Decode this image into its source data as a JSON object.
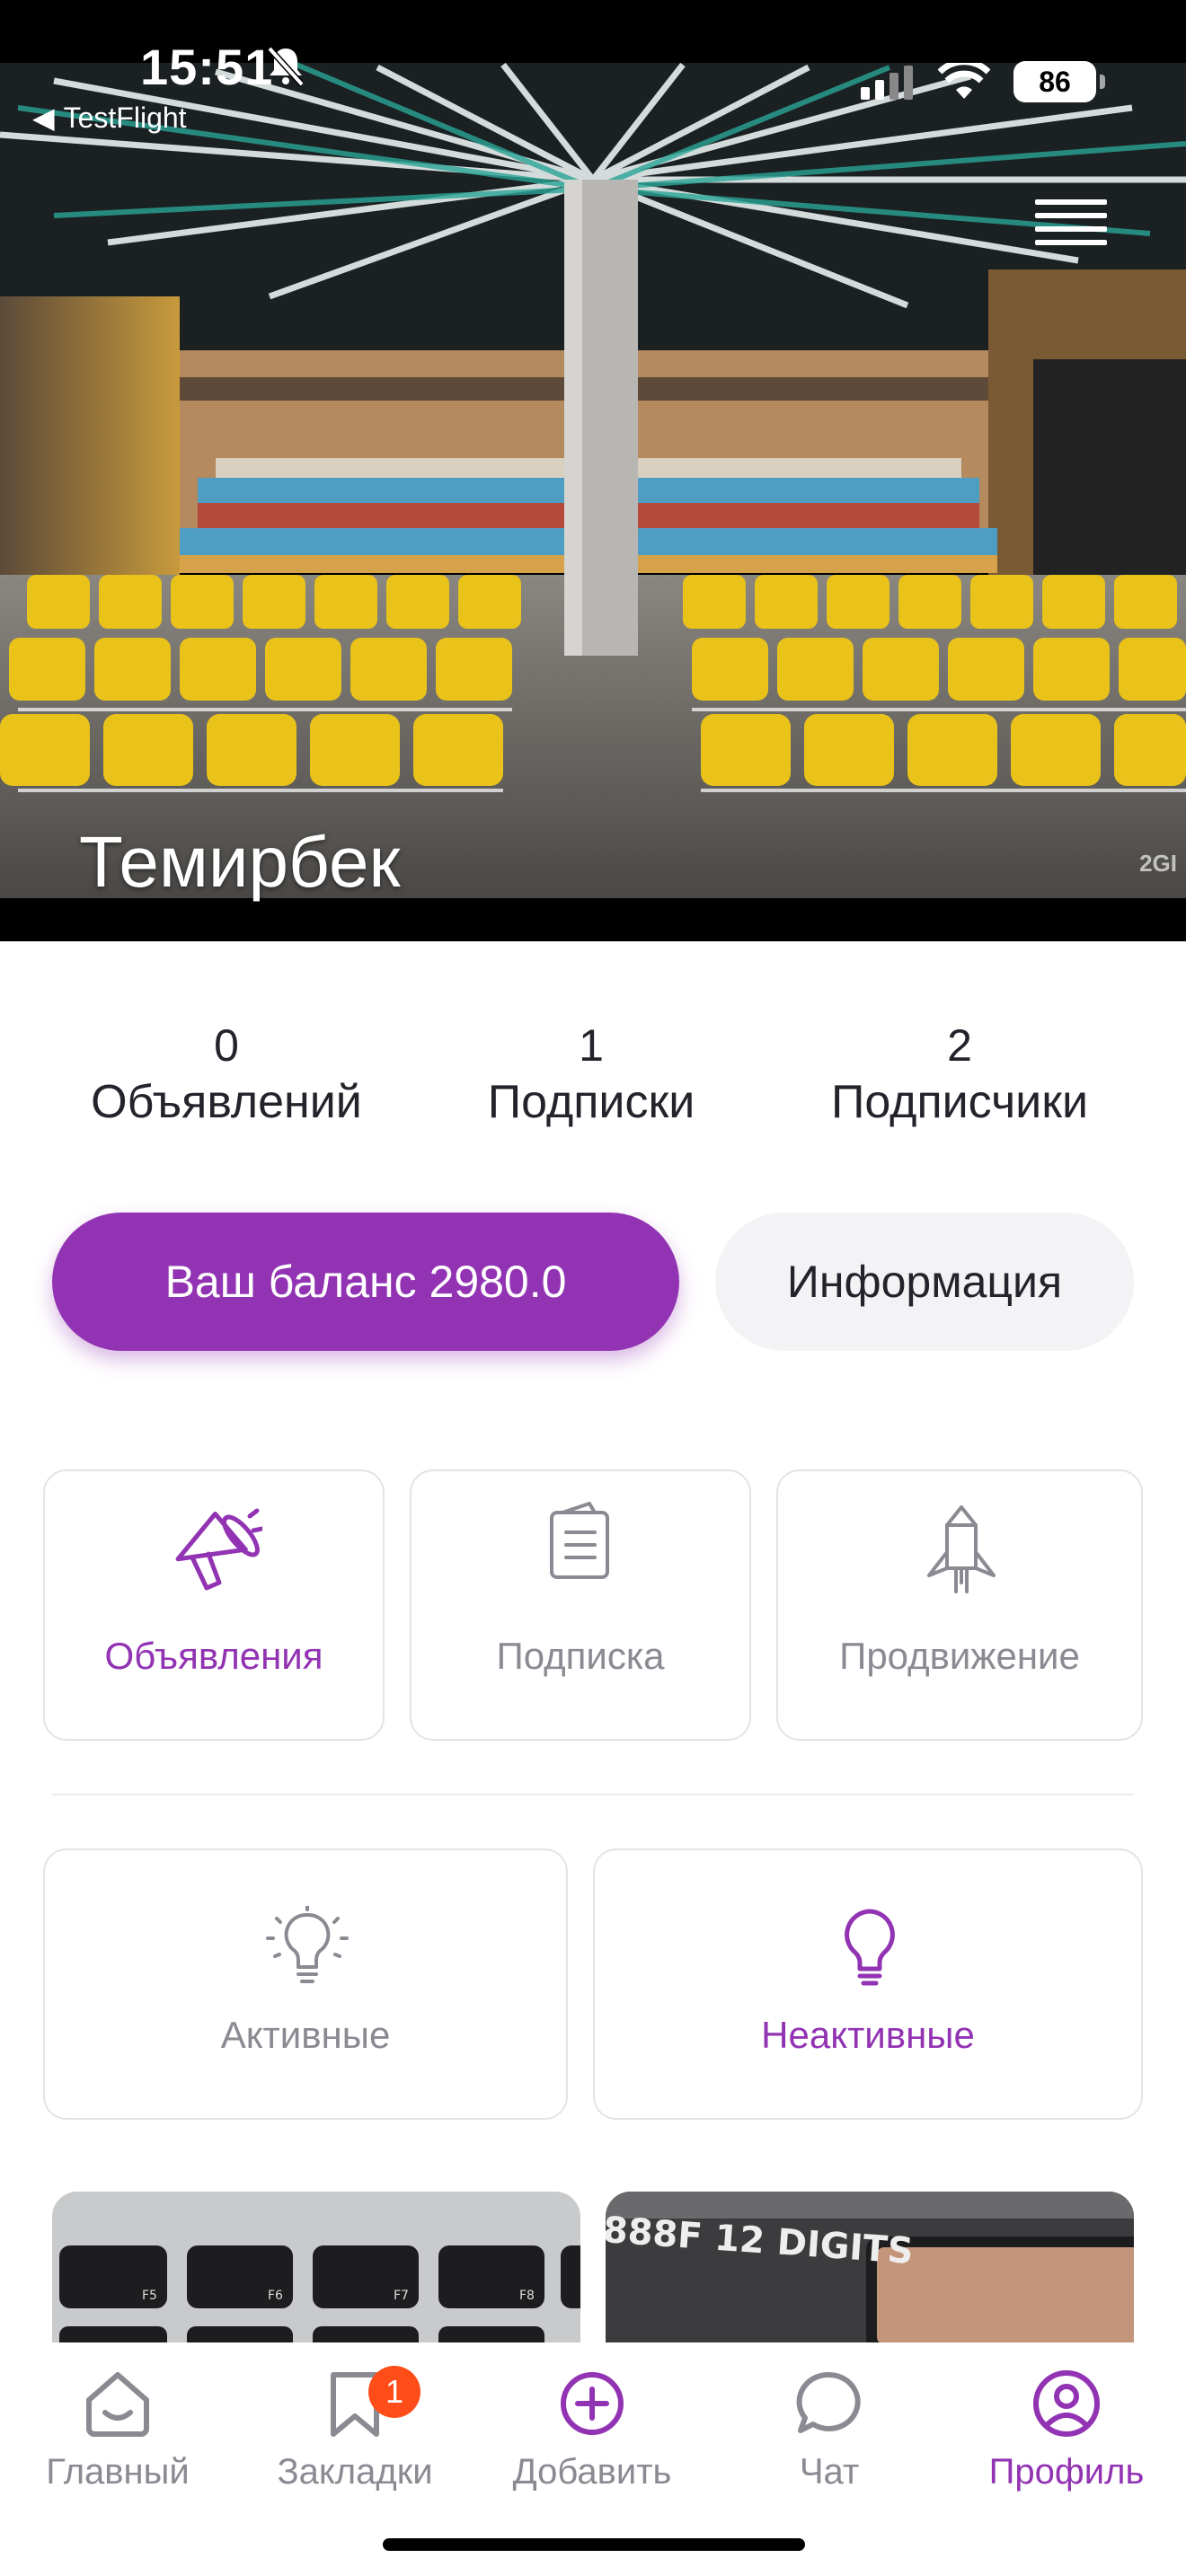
{
  "status_bar": {
    "time": "15:51",
    "back_app": "TestFlight",
    "battery": "86"
  },
  "profile": {
    "name": "Темирбек",
    "watermark": "2GI"
  },
  "stats": [
    {
      "value": "0",
      "label": "Объявлений"
    },
    {
      "value": "1",
      "label": "Подписки"
    },
    {
      "value": "2",
      "label": "Подписчики"
    }
  ],
  "buttons": {
    "balance": "Ваш баланс 2980.0",
    "info": "Информация"
  },
  "sections": [
    {
      "label": "Объявления",
      "icon": "megaphone-icon",
      "active": true
    },
    {
      "label": "Подписка",
      "icon": "document-icon",
      "active": false
    },
    {
      "label": "Продвижение",
      "icon": "rocket-icon",
      "active": false
    }
  ],
  "filters": [
    {
      "label": "Активные",
      "icon": "lightbulb-on-icon",
      "active": false
    },
    {
      "label": "Неактивные",
      "icon": "lightbulb-icon",
      "active": true
    }
  ],
  "thumbs": {
    "right_text": "888F 12 DIGITS"
  },
  "tabbar": [
    {
      "label": "Главный",
      "icon": "home-icon"
    },
    {
      "label": "Закладки",
      "icon": "bookmark-icon",
      "badge": "1"
    },
    {
      "label": "Добавить",
      "icon": "add-circle-icon"
    },
    {
      "label": "Чат",
      "icon": "chat-icon"
    },
    {
      "label": "Профиль",
      "icon": "profile-icon",
      "active": true
    }
  ],
  "colors": {
    "accent": "#9233b3",
    "badge": "#ff4d1a",
    "muted": "#8a8a92"
  }
}
